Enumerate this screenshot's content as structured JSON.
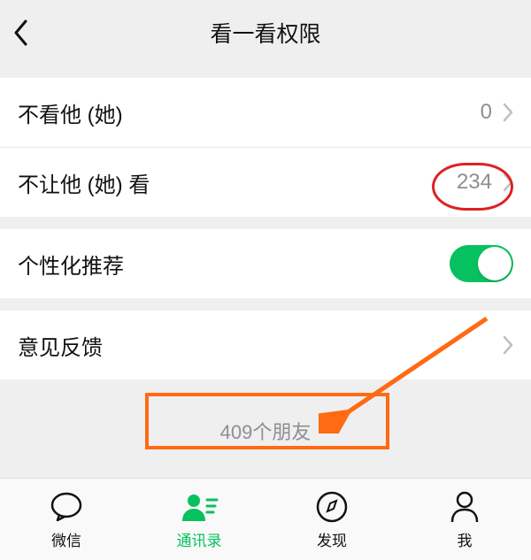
{
  "header": {
    "title": "看一看权限"
  },
  "groups": {
    "privacy": {
      "hide_from_me": {
        "label": "不看他 (她)",
        "value": "0"
      },
      "hide_from_them": {
        "label": "不让他 (她) 看",
        "value": "234"
      }
    },
    "recommend": {
      "label": "个性化推荐",
      "on": true
    },
    "feedback": {
      "label": "意见反馈"
    }
  },
  "friend_count_text": "409个朋友",
  "tabs": {
    "chats": {
      "label": "微信"
    },
    "contacts": {
      "label": "通讯录"
    },
    "discover": {
      "label": "发现"
    },
    "me": {
      "label": "我"
    }
  },
  "colors": {
    "accent": "#07c160",
    "annotation_red": "#d22",
    "annotation_orange": "#ff6a13"
  }
}
